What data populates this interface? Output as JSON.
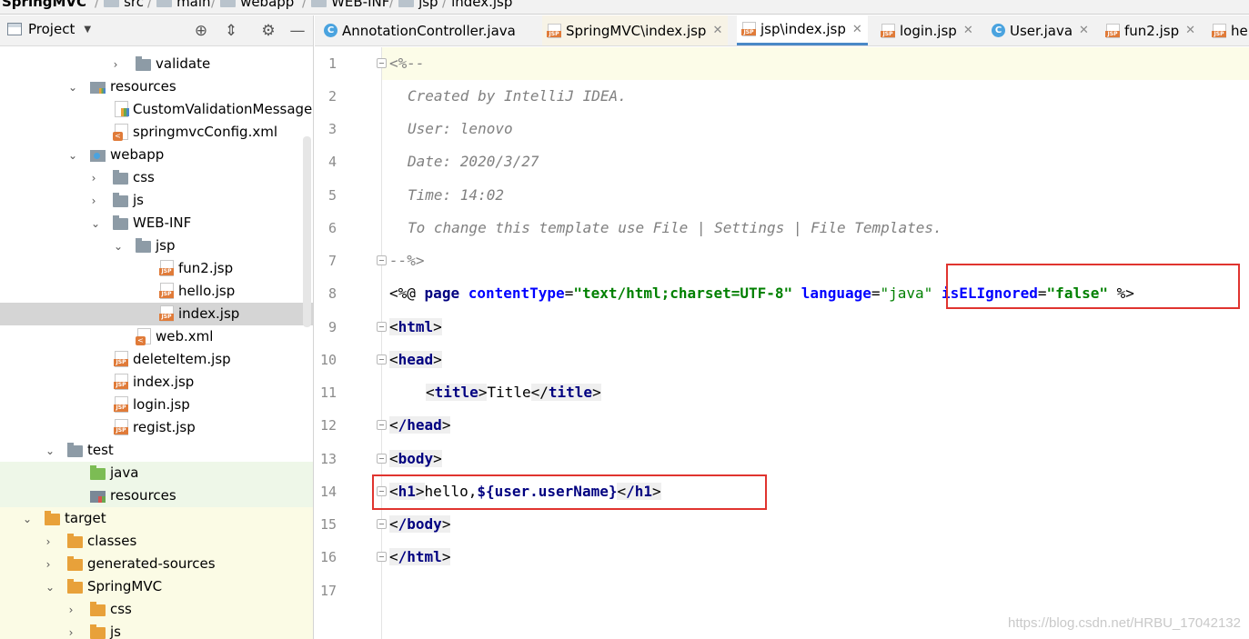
{
  "breadcrumb": {
    "project": "SpringMVC",
    "items": [
      "src",
      "main",
      "webapp",
      "WEB-INF",
      "jsp",
      "index.jsp"
    ]
  },
  "project_panel": {
    "title": "Project",
    "tree": [
      {
        "label": "validate",
        "icon": "folder-icon",
        "expanded": false
      },
      {
        "label": "resources",
        "icon": "resources-folder-icon",
        "expanded": true
      },
      {
        "label": "CustomValidationMessage.",
        "icon": "properties-file-icon"
      },
      {
        "label": "springmvcConfig.xml",
        "icon": "xml-file-icon"
      },
      {
        "label": "webapp",
        "icon": "web-folder-icon",
        "expanded": true
      },
      {
        "label": "css",
        "icon": "folder-icon",
        "expanded": false
      },
      {
        "label": "js",
        "icon": "folder-icon",
        "expanded": false
      },
      {
        "label": "WEB-INF",
        "icon": "folder-icon",
        "expanded": true
      },
      {
        "label": "jsp",
        "icon": "folder-icon",
        "expanded": true
      },
      {
        "label": "fun2.jsp",
        "icon": "jsp-file-icon"
      },
      {
        "label": "hello.jsp",
        "icon": "jsp-file-icon"
      },
      {
        "label": "index.jsp",
        "icon": "jsp-file-icon",
        "selected": true
      },
      {
        "label": "web.xml",
        "icon": "xml-file-icon"
      },
      {
        "label": "deleteItem.jsp",
        "icon": "jsp-file-icon"
      },
      {
        "label": "index.jsp",
        "icon": "jsp-file-icon"
      },
      {
        "label": "login.jsp",
        "icon": "jsp-file-icon"
      },
      {
        "label": "regist.jsp",
        "icon": "jsp-file-icon"
      },
      {
        "label": "test",
        "icon": "folder-icon",
        "expanded": true
      },
      {
        "label": "java",
        "icon": "test-source-folder-icon"
      },
      {
        "label": "resources",
        "icon": "test-resources-folder-icon"
      },
      {
        "label": "target",
        "icon": "excluded-folder-icon",
        "expanded": true
      },
      {
        "label": "classes",
        "icon": "excluded-folder-icon",
        "expanded": false
      },
      {
        "label": "generated-sources",
        "icon": "excluded-folder-icon",
        "expanded": false
      },
      {
        "label": "SpringMVC",
        "icon": "excluded-folder-icon",
        "expanded": true
      },
      {
        "label": "css",
        "icon": "excluded-folder-icon",
        "expanded": false
      },
      {
        "label": "js",
        "icon": "excluded-folder-icon",
        "expanded": false
      }
    ]
  },
  "tabs": [
    {
      "label": "AnnotationController.java",
      "icon": "java-class-icon"
    },
    {
      "label": "SpringMVC\\index.jsp",
      "icon": "jsp-file-icon"
    },
    {
      "label": "jsp\\index.jsp",
      "icon": "jsp-file-icon",
      "active": true
    },
    {
      "label": "login.jsp",
      "icon": "jsp-file-icon"
    },
    {
      "label": "User.java",
      "icon": "java-class-icon"
    },
    {
      "label": "fun2.jsp",
      "icon": "jsp-file-icon"
    },
    {
      "label": "he",
      "icon": "jsp-file-icon"
    }
  ],
  "editor": {
    "line_numbers": [
      "1",
      "2",
      "3",
      "4",
      "5",
      "6",
      "7",
      "8",
      "9",
      "10",
      "11",
      "12",
      "13",
      "14",
      "15",
      "16",
      "17"
    ],
    "comment_open": "<%--",
    "comment_lines": [
      "Created by IntelliJ IDEA.",
      "User: lenovo",
      "Date: 2020/3/27",
      "Time: 14:02",
      "To change this template use File | Settings | File Templates."
    ],
    "comment_close": "--%>",
    "directive": {
      "open": "<%@",
      "keyword": "page",
      "attr1": "contentType",
      "val1": "\"text/html;charset=UTF-8\"",
      "attr2": "language",
      "val2": "\"java\"",
      "attr3": "isELIgnored",
      "val3": "\"false\"",
      "close": "%>"
    },
    "html_open": "html",
    "head_open": "head",
    "title_tag": "title",
    "title_text": "Title",
    "head_close": "/head",
    "body_open": "body",
    "h1_tag": "h1",
    "h1_text": "hello,",
    "el_expr": "${user.userName}",
    "h1_close": "/h1",
    "body_close": "/body",
    "html_close": "/html"
  },
  "watermark": "https://blog.csdn.net/HRBU_17042132",
  "colors": {
    "highlight_box": "#e0342f",
    "active_tab_underline": "#4a88c7"
  }
}
